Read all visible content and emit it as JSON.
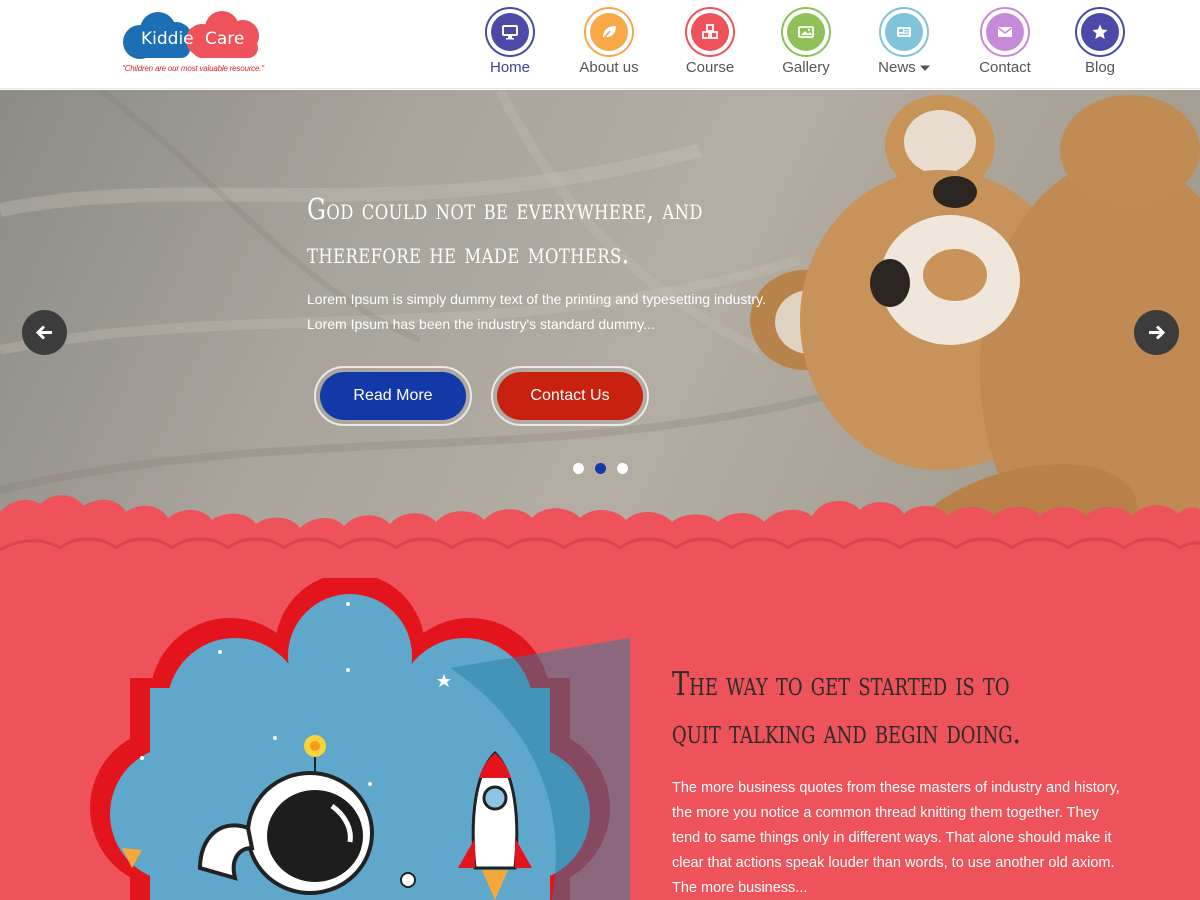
{
  "logo": {
    "word1": "Kiddie",
    "word2": "Care",
    "tagline": "\"Children are our most valuable resource.\""
  },
  "nav": {
    "items": [
      {
        "label": "Home",
        "icon": "monitor-icon",
        "color": "#4b4aa8",
        "active": true
      },
      {
        "label": "About us",
        "icon": "leaf-icon",
        "color": "#f7a94a",
        "active": false
      },
      {
        "label": "Course",
        "icon": "cubes-icon",
        "color": "#ee525a",
        "active": false
      },
      {
        "label": "Gallery",
        "icon": "image-icon",
        "color": "#8fc158",
        "active": false
      },
      {
        "label": "News",
        "icon": "newspaper-icon",
        "color": "#7fc3dd",
        "active": false,
        "has_dropdown": true,
        "dropdown_icon": "caret-down-icon"
      },
      {
        "label": "Contact",
        "icon": "envelope-icon",
        "color": "#c58bd8",
        "active": false
      },
      {
        "label": "Blog",
        "icon": "star-icon",
        "color": "#4b4aa8",
        "active": false
      }
    ]
  },
  "hero": {
    "title": "God could not be everywhere, and therefore he made mothers.",
    "text": "Lorem Ipsum is simply dummy text of the printing and typesetting industry. Lorem Ipsum has been the industry's standard dummy...",
    "read_more_label": "Read More",
    "contact_label": "Contact Us",
    "read_more_color": "#1339a8",
    "contact_color": "#c8210f",
    "prev_icon": "arrow-left-icon",
    "next_icon": "arrow-right-icon",
    "dots_total": 3,
    "dots_active_index": 1,
    "dot_active_color": "#1339a8"
  },
  "section": {
    "title": "The way to get started is to quit talking and begin doing.",
    "text": "The more business quotes from these masters of industry and history, the more you notice a common thread knitting them together. They tend to same things only in different ways. That alone should make it clear that actions speak louder than words, to use another old axiom. The more business...",
    "background": "#ee525a"
  }
}
